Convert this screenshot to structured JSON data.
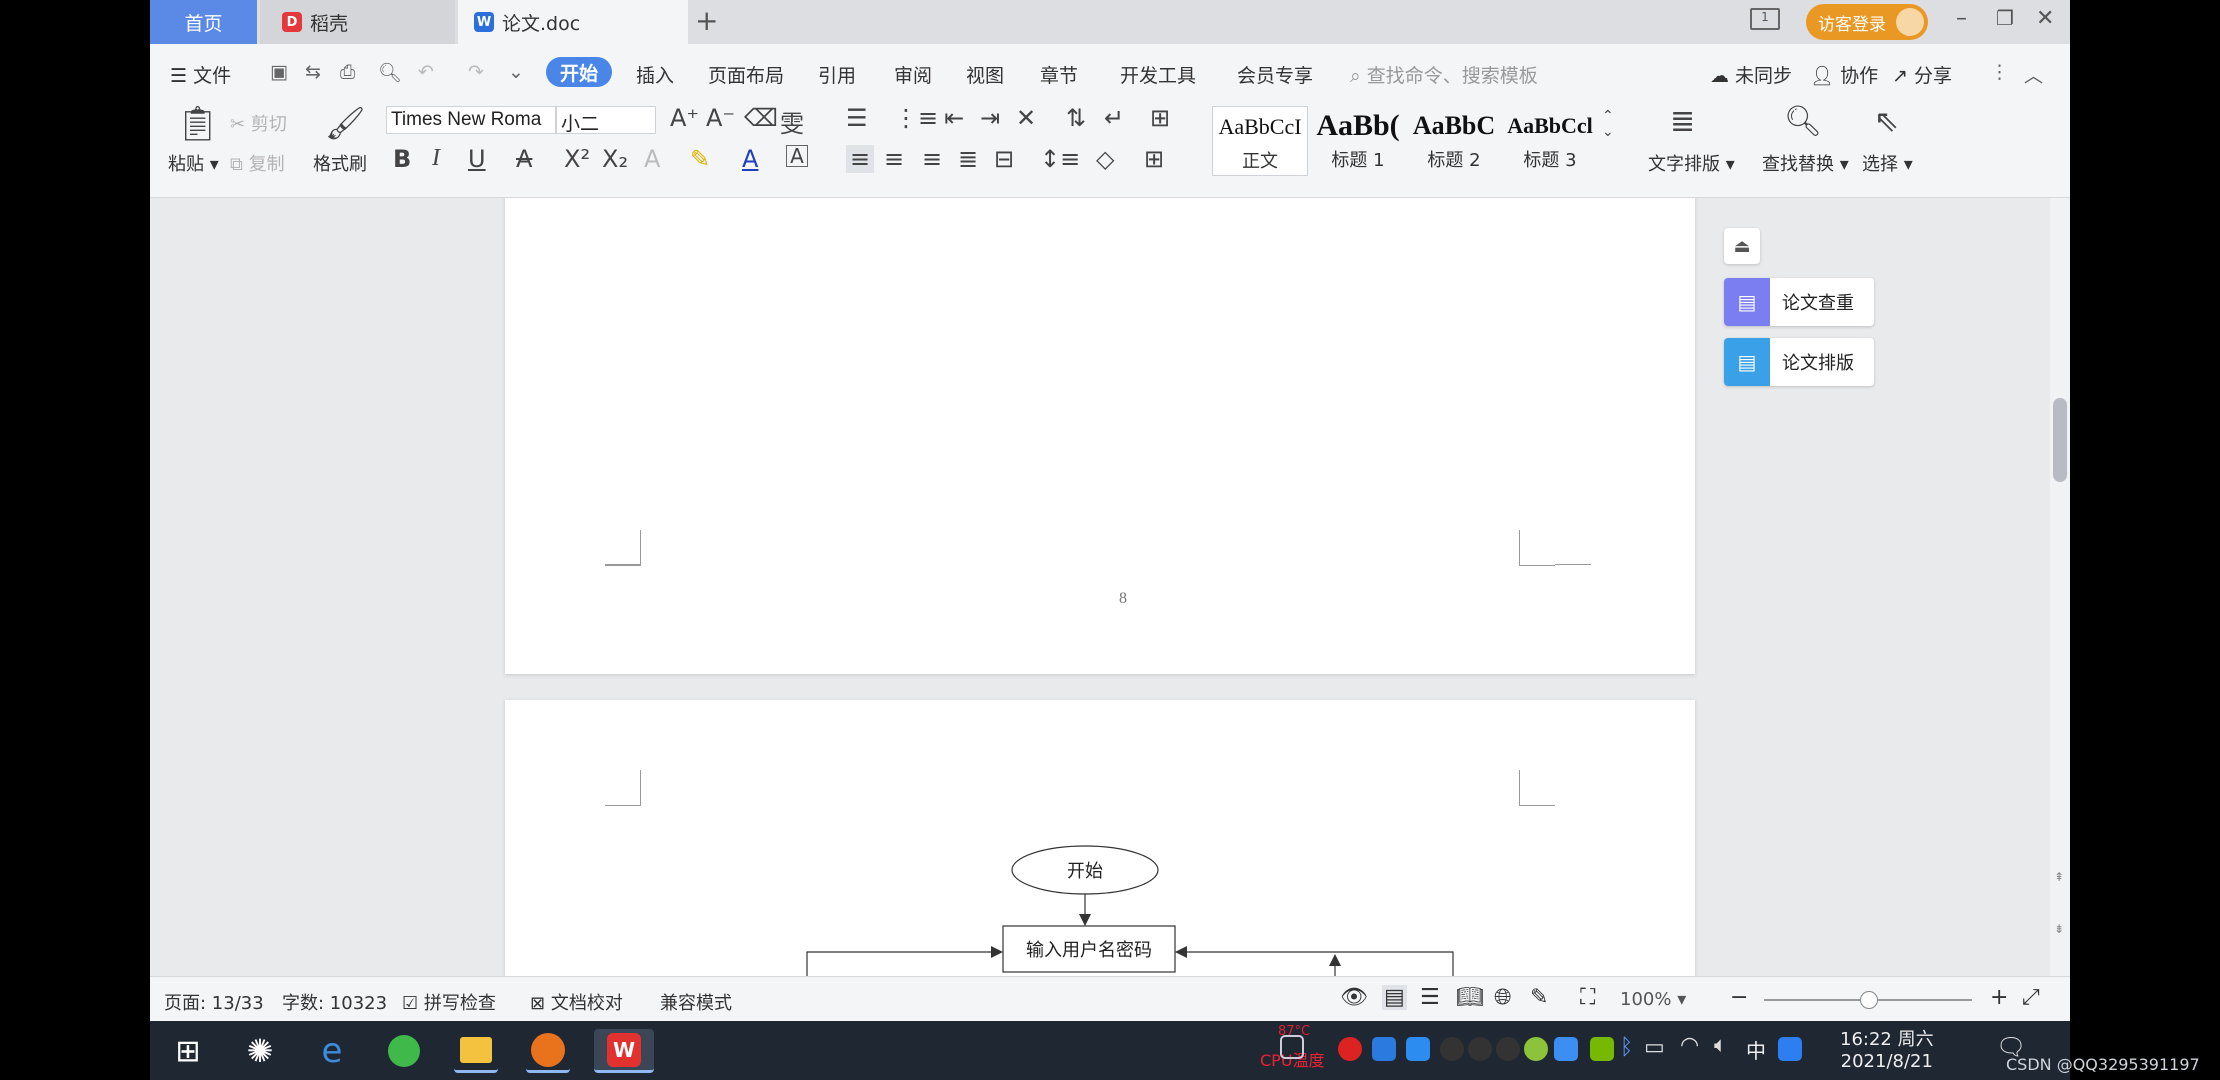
{
  "tabs": {
    "home": "首页",
    "daoke": "稻壳",
    "doc": "论文.doc"
  },
  "window": {
    "login": "访客登录"
  },
  "menu": {
    "file": "文件",
    "items": [
      "开始",
      "插入",
      "页面布局",
      "引用",
      "审阅",
      "视图",
      "章节",
      "开发工具",
      "会员专享"
    ],
    "search_placeholder": "查找命令、搜索模板",
    "unsync": "未同步",
    "collab": "协作",
    "share": "分享"
  },
  "ribbon": {
    "paste": "粘贴",
    "cut": "剪切",
    "copy": "复制",
    "format_painter": "格式刷",
    "font_name": "Times New Roma",
    "font_size": "小二",
    "styles": [
      {
        "preview": "AaBbCcI",
        "name": "正文"
      },
      {
        "preview": "AaBb(",
        "name": "标题 1"
      },
      {
        "preview": "AaBbC",
        "name": "标题 2"
      },
      {
        "preview": "AaBbCcl",
        "name": "标题 3"
      }
    ],
    "text_layout": "文字排版",
    "find_replace": "查找替换",
    "select": "选择"
  },
  "document": {
    "page_number": "8",
    "flow_start": "开始",
    "flow_input": "输入用户名密码"
  },
  "side_panel": {
    "check": "论文查重",
    "format": "论文排版"
  },
  "status": {
    "page": "页面: 13/33",
    "words": "字数: 10323",
    "spell": "拼写检查",
    "proof": "文档校对",
    "compat": "兼容模式",
    "zoom": "100%"
  },
  "taskbar": {
    "ime": "中",
    "time": "16:22 周六",
    "date": "2021/8/21",
    "cpu_temp": "87°C",
    "cpu_label": "CPU温度",
    "watermark": "CSDN @QQ3295391197"
  }
}
